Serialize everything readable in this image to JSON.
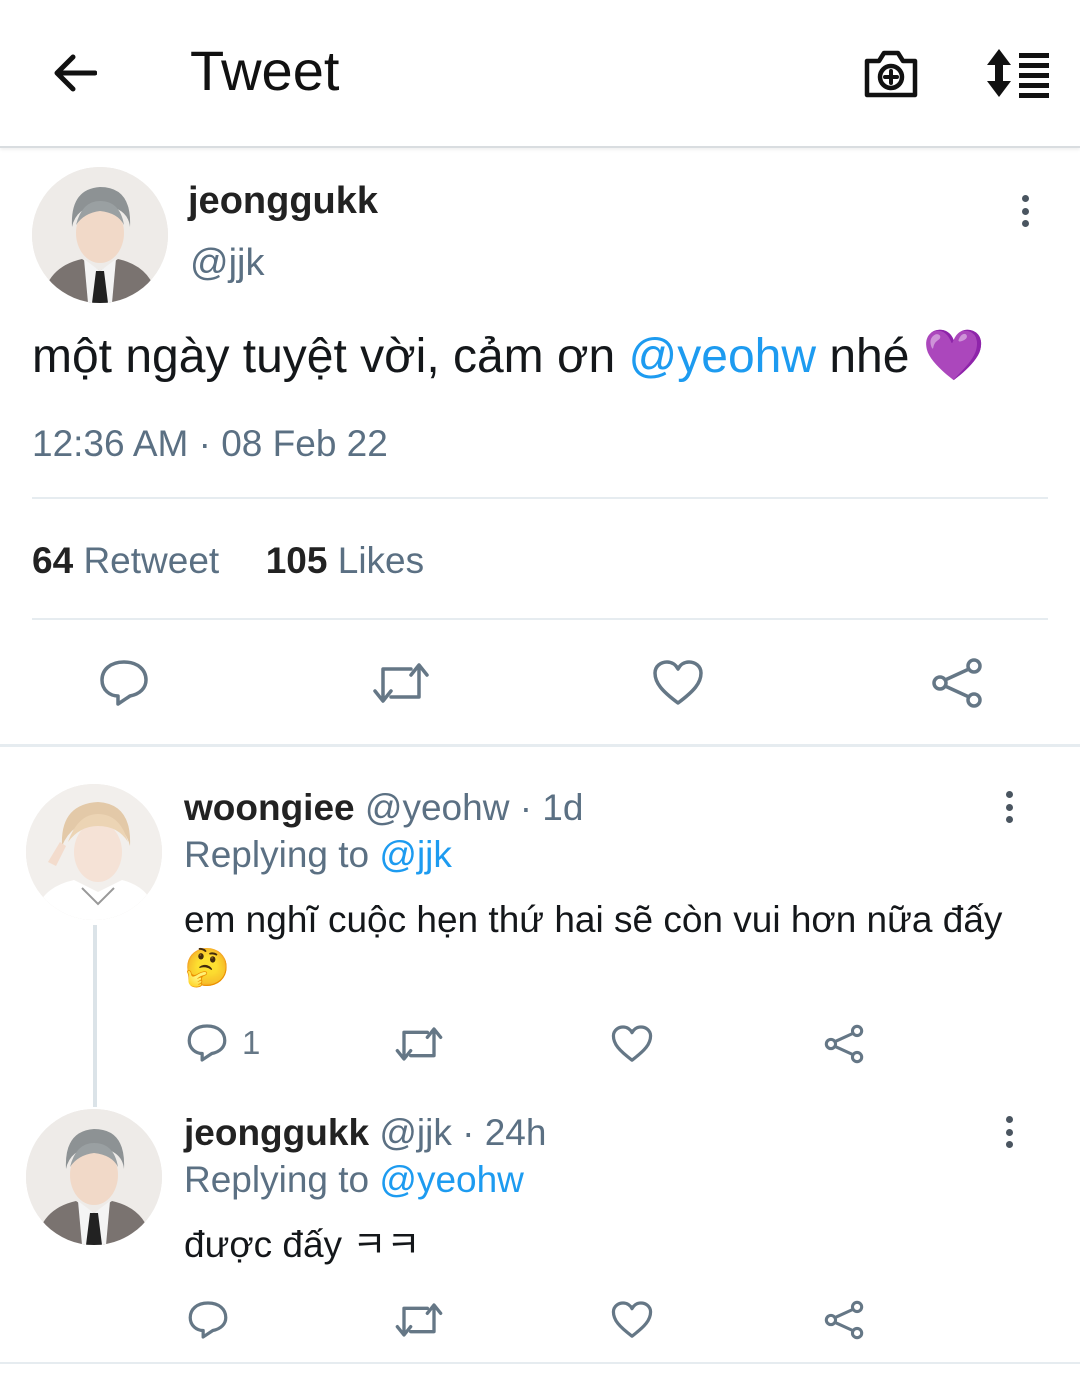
{
  "header": {
    "title": "Tweet",
    "back_icon": "arrow-left-icon",
    "camera_icon": "camera-plus-icon",
    "sort_icon": "sort-list-icon"
  },
  "tweet": {
    "display_name": "jeonggukk",
    "handle": "@jjk",
    "text_before": "một ngày tuyệt vời, cảm ơn ",
    "mention": "@yeohw",
    "text_after": " nhé ",
    "emoji": "💜",
    "timestamp": "12:36 AM · 08 Feb 22",
    "retweet_count": "64",
    "retweet_label": "Retweet",
    "likes_count": "105",
    "likes_label": "Likes"
  },
  "replies": [
    {
      "display_name": "woongiee",
      "handle_time": "@yeohw · 1d",
      "replying_label": "Replying to ",
      "replying_to": "@jjk",
      "text": "em nghĩ cuộc hẹn thứ hai sẽ còn vui hơn nữa đấy 🤔",
      "reply_count": "1"
    },
    {
      "display_name": "jeonggukk",
      "handle_time": "@jjk · 24h",
      "replying_label": "Replying to ",
      "replying_to": "@yeohw",
      "text": "được đấy ㅋㅋ",
      "reply_count": ""
    }
  ],
  "colors": {
    "accent": "#1d9bf0",
    "secondary_text": "#5b7083",
    "divider": "#e6ecf0"
  }
}
